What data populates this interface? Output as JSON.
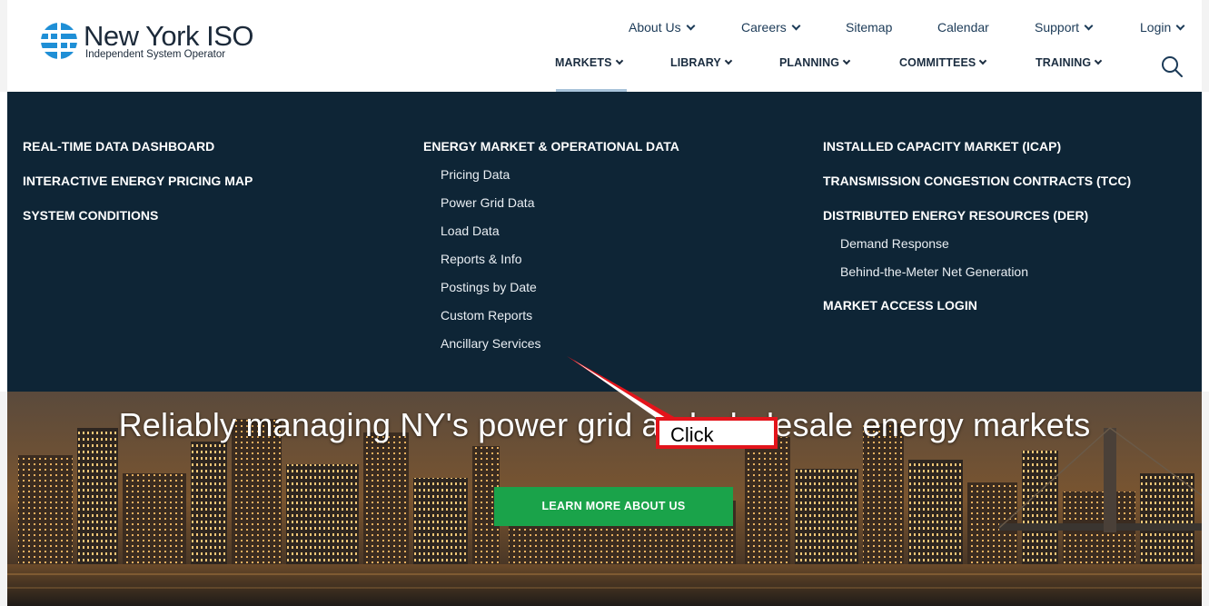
{
  "header": {
    "logo": {
      "name": "New York ISO",
      "subtitle": "Independent System Operator"
    },
    "utility_nav": [
      {
        "label": "About Us",
        "has_dropdown": true
      },
      {
        "label": "Careers",
        "has_dropdown": true
      },
      {
        "label": "Sitemap",
        "has_dropdown": false
      },
      {
        "label": "Calendar",
        "has_dropdown": false
      },
      {
        "label": "Support",
        "has_dropdown": true
      },
      {
        "label": "Login",
        "has_dropdown": true
      }
    ],
    "main_nav": [
      {
        "label": "MARKETS",
        "active": true
      },
      {
        "label": "LIBRARY",
        "active": false
      },
      {
        "label": "PLANNING",
        "active": false
      },
      {
        "label": "COMMITTEES",
        "active": false
      },
      {
        "label": "TRAINING",
        "active": false
      }
    ],
    "search_icon": "search-icon"
  },
  "mega_menu": {
    "col1": {
      "headings": [
        "REAL-TIME DATA DASHBOARD",
        "INTERACTIVE ENERGY PRICING MAP",
        "SYSTEM CONDITIONS"
      ]
    },
    "col2": {
      "heading": "ENERGY MARKET & OPERATIONAL DATA",
      "items": [
        "Pricing Data",
        "Power Grid Data",
        "Load Data",
        "Reports & Info",
        "Postings by Date",
        "Custom Reports",
        "Ancillary Services"
      ]
    },
    "col3": {
      "heading1": "INSTALLED CAPACITY MARKET (ICAP)",
      "heading2": "TRANSMISSION CONGESTION CONTRACTS (TCC)",
      "heading3": "DISTRIBUTED ENERGY RESOURCES (DER)",
      "der_items": [
        "Demand Response",
        "Behind-the-Meter Net Generation"
      ],
      "heading4": "MARKET ACCESS LOGIN"
    }
  },
  "hero": {
    "title": "Reliably managing NY's power grid and wholesale energy markets",
    "cta": "LEARN MORE ABOUT US"
  },
  "annotation": {
    "label": "Click"
  },
  "colors": {
    "menu_bg": "#0e2536",
    "cta_green": "#1aa34a",
    "annotation_red": "#e3141b",
    "logo_blue": "#1f8fd6"
  }
}
